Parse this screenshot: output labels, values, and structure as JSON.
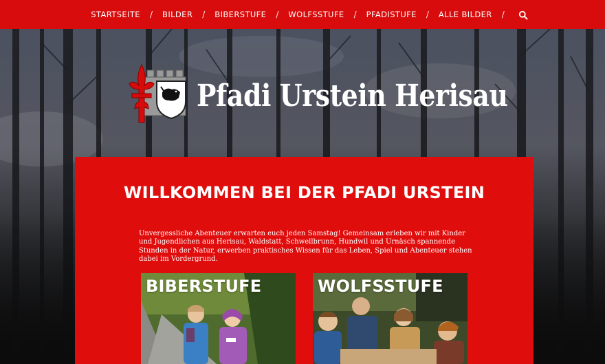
{
  "nav": {
    "items": [
      {
        "label": "STARTSEITE"
      },
      {
        "label": "BILDER"
      },
      {
        "label": "BIBERSTUFE"
      },
      {
        "label": "WOLFSSTUFE"
      },
      {
        "label": "PFADISTUFE"
      },
      {
        "label": "ALLE BILDER"
      }
    ],
    "separator": "/",
    "search_icon": "search-icon"
  },
  "logo": {
    "text": "Pfadi Urstein Herisau",
    "emblem_icon": "scout-emblem-icon"
  },
  "welcome": {
    "title": "WILLKOMMEN BEI DER PFADI URSTEIN",
    "text": "Unvergessliche Abenteuer erwarten euch jeden Samstag! Gemeinsam erleben wir mit Kinder und Jugendlichen aus Herisau, Waldstatt, Schwellbrunn, Hundwil und Urnäsch spannende Stunden in der Natur, erwerben praktisches Wissen für das Leben, Spiel und Abenteuer stehen dabei im Vordergrund."
  },
  "cards": [
    {
      "title": "BIBERSTUFE"
    },
    {
      "title": "WOLFSSTUFE"
    }
  ],
  "colors": {
    "brand_red": "#d80c0c",
    "panel_red": "#e00d0d",
    "text": "#ffffff"
  }
}
